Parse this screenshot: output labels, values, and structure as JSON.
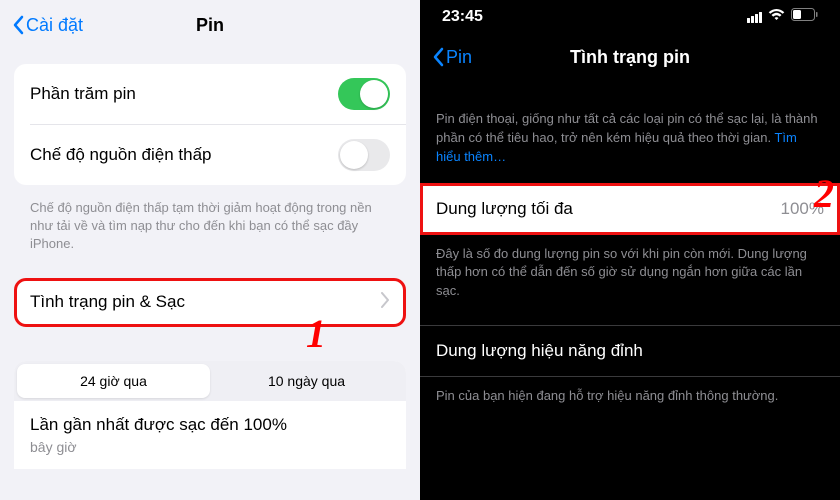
{
  "left": {
    "back": "Cài đặt",
    "title": "Pin",
    "percentRow": "Phần trăm pin",
    "lowPowerRow": "Chế độ nguồn điện thấp",
    "lowPowerDesc": "Chế độ nguồn điện thấp tạm thời giảm hoạt động trong nền như tải về và tìm nạp thư cho đến khi bạn có thể sạc đầy iPhone.",
    "healthRow": "Tình trạng pin & Sạc",
    "seg24h": "24 giờ qua",
    "seg10d": "10 ngày qua",
    "lastChargeLabel": "Lần gần nhất được sạc đến 100%",
    "lastChargeTime": "bây giờ",
    "marker": "1"
  },
  "right": {
    "time": "23:45",
    "back": "Pin",
    "title": "Tình trạng pin",
    "intro": "Pin điện thoại, giống như tất cả các loại pin có thể sạc lại, là thành phần có thể tiêu hao, trở nên kém hiệu quả theo thời gian. ",
    "introLink": "Tìm hiểu thêm…",
    "maxCapLabel": "Dung lượng tối đa",
    "maxCapValue": "100%",
    "maxCapDesc": "Đây là số đo dung lượng pin so với khi pin còn mới. Dung lượng thấp hơn có thể dẫn đến số giờ sử dụng ngắn hơn giữa các lần sạc.",
    "peakLabel": "Dung lượng hiệu năng đỉnh",
    "peakDesc": "Pin của bạn hiện đang hỗ trợ hiệu năng đỉnh thông thường.",
    "marker": "2"
  }
}
